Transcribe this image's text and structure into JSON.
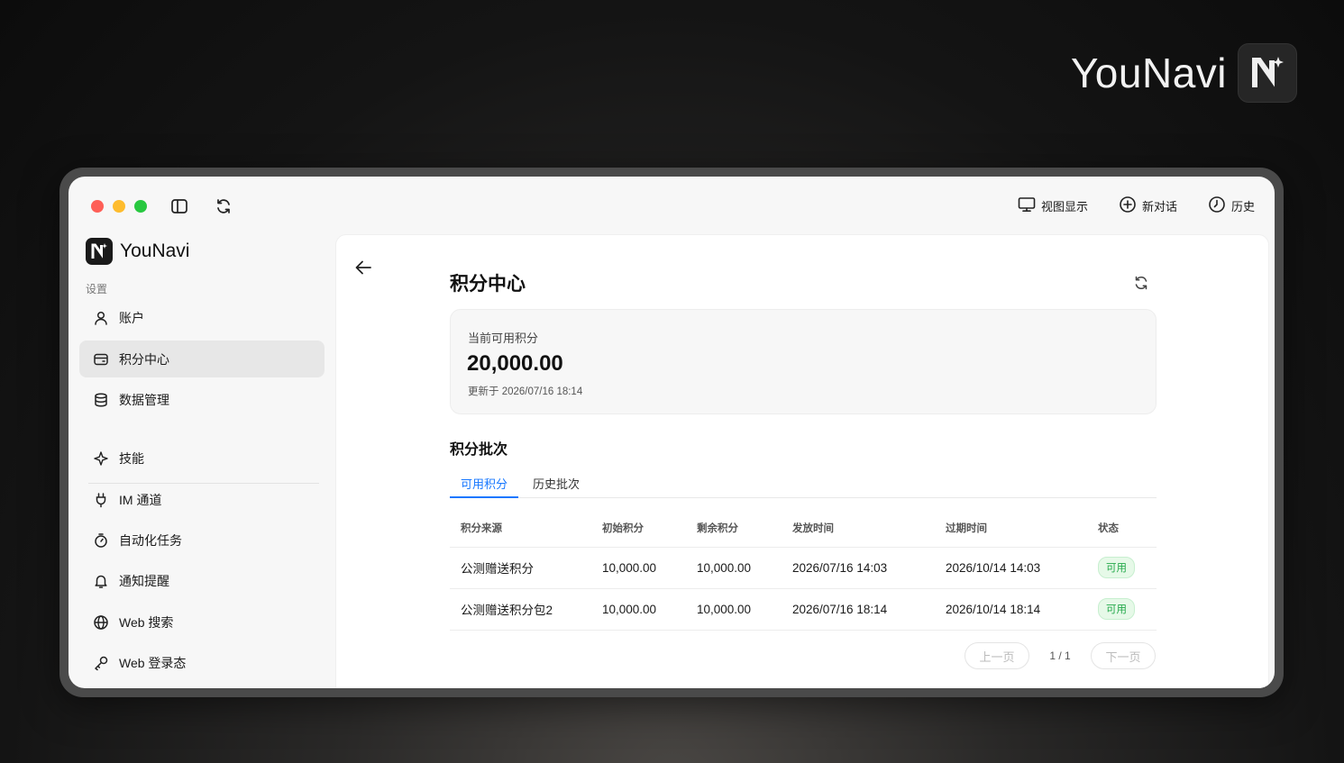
{
  "backdrop": {
    "brand_name": "YouNavi",
    "brand_logo_icon": "younavi-n-sparkle-icon"
  },
  "topbar": {
    "sidebar_toggle_icon": "sidebar-toggle-icon",
    "refresh_icon": "refresh-icon",
    "actions": [
      {
        "label": "视图显示",
        "icon": "monitor-icon"
      },
      {
        "label": "新对话",
        "icon": "plus-circle-icon"
      },
      {
        "label": "历史",
        "icon": "clock-icon"
      }
    ]
  },
  "sidebar": {
    "brand_name": "YouNavi",
    "section_label": "设置",
    "items": [
      {
        "label": "账户",
        "icon": "user-icon",
        "active": false
      },
      {
        "label": "积分中心",
        "icon": "wallet-icon",
        "active": true
      },
      {
        "label": "数据管理",
        "icon": "database-icon",
        "active": false
      },
      {
        "label": "技能",
        "icon": "sparkle-icon",
        "active": false
      },
      {
        "label": "IM 通道",
        "icon": "plug-icon",
        "active": false
      },
      {
        "label": "自动化任务",
        "icon": "timer-icon",
        "active": false
      },
      {
        "label": "通知提醒",
        "icon": "bell-icon",
        "active": false
      },
      {
        "label": "Web 搜索",
        "icon": "globe-icon",
        "active": false
      },
      {
        "label": "Web 登录态",
        "icon": "key-icon",
        "active": false
      }
    ]
  },
  "main": {
    "title": "积分中心",
    "balance": {
      "label": "当前可用积分",
      "value": "20,000.00",
      "updated": "更新于 2026/07/16 18:14"
    },
    "batches_title": "积分批次",
    "tabs": [
      {
        "label": "可用积分",
        "active": true
      },
      {
        "label": "历史批次",
        "active": false
      }
    ],
    "table": {
      "headers": [
        "积分来源",
        "初始积分",
        "剩余积分",
        "发放时间",
        "过期时间",
        "状态"
      ],
      "rows": [
        {
          "source": "公测赠送积分",
          "initial": "10,000.00",
          "remaining": "10,000.00",
          "issued": "2026/07/16 14:03",
          "expires": "2026/10/14 14:03",
          "status": "可用"
        },
        {
          "source": "公测赠送积分包2",
          "initial": "10,000.00",
          "remaining": "10,000.00",
          "issued": "2026/07/16 18:14",
          "expires": "2026/10/14 18:14",
          "status": "可用"
        }
      ]
    },
    "pager": {
      "prev": "上一页",
      "info": "1 / 1",
      "next": "下一页"
    }
  },
  "colors": {
    "accent": "#1677ff",
    "status_green": "#23a94a"
  }
}
